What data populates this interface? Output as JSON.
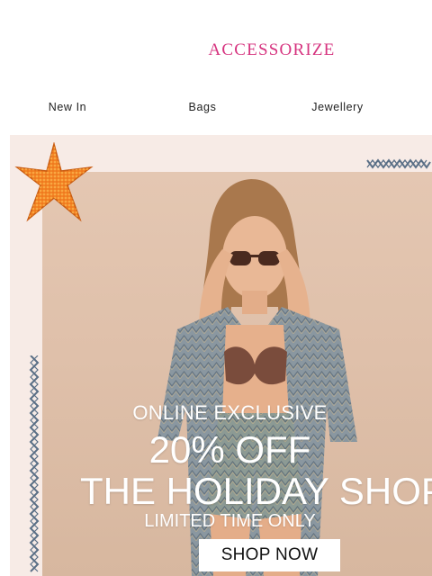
{
  "brand": {
    "logo_text": "ACCESSORIZE",
    "logo_color": "#d6337f"
  },
  "nav": {
    "items": [
      {
        "label": "New In"
      },
      {
        "label": "Bags"
      },
      {
        "label": "Jewellery"
      }
    ]
  },
  "hero": {
    "line1": "ONLINE EXCLUSIVE",
    "line2": "20% OFF",
    "line3": "THE HOLIDAY SHOP",
    "line4": "LIMITED TIME ONLY",
    "cta_label": "SHOP NOW",
    "background_color": "#f7ebe6",
    "starfish_color": "#f07a1e",
    "stitch_color": "#5a6f86"
  }
}
